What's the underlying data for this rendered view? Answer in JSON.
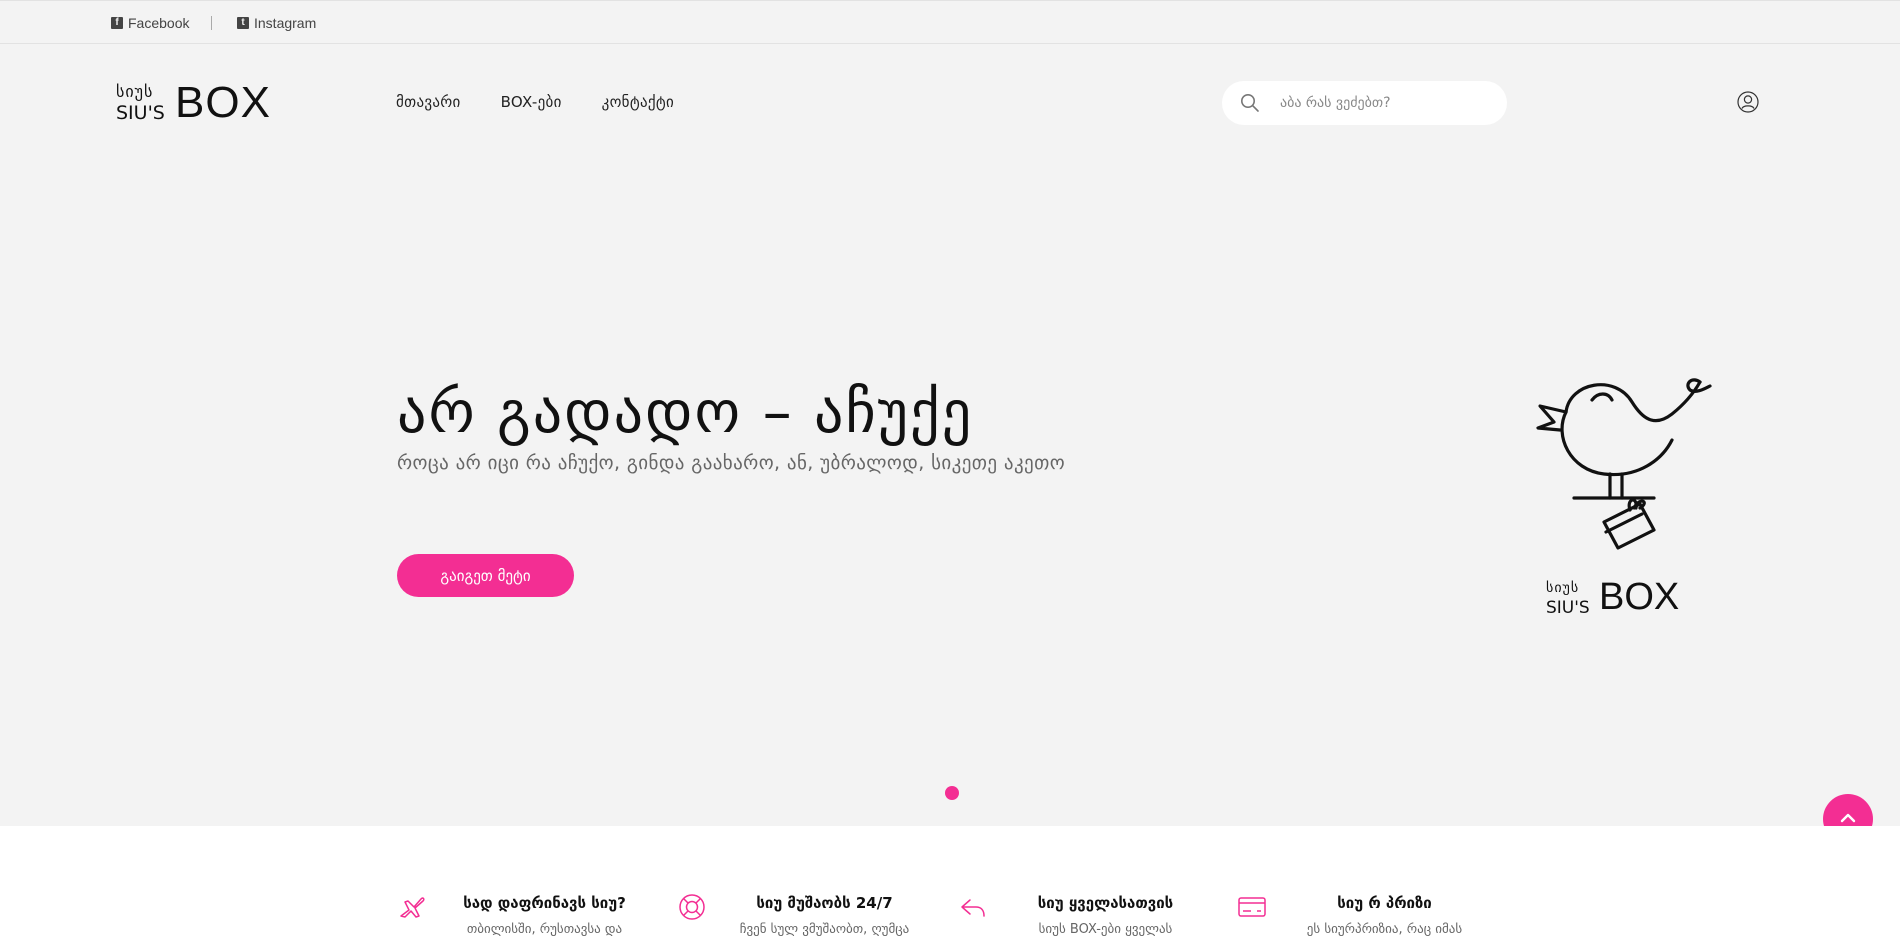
{
  "topbar": {
    "facebook_label": "Facebook",
    "instagram_label": "Instagram"
  },
  "logo": {
    "line1": "სიუს",
    "line2": "SIU'S",
    "word": "BOX"
  },
  "nav": {
    "items": [
      {
        "label": "მთავარი"
      },
      {
        "label": "BOX-ები"
      },
      {
        "label": "კონტაქტი"
      }
    ]
  },
  "search": {
    "placeholder": "აბა რას ვეძებთ?"
  },
  "hero": {
    "title": "არ გადადო – აჩუქე",
    "subtitle": "როცა არ იცი რა აჩუქო, გინდა გაახარო, ან, უბრალოდ, სიკეთე აკეთო",
    "button_label": "გაიგეთ მეტი"
  },
  "hero_logo": {
    "line1": "სიუს",
    "line2": "SIU'S",
    "word": "BOX"
  },
  "features": [
    {
      "icon": "airplane-icon",
      "title": "სად დაფრინავს სიუ?",
      "text": "თბილისში, რუსთავსა და"
    },
    {
      "icon": "lifebuoy-icon",
      "title": "სიუ მუშაობს 24/7",
      "text": "ჩვენ სულ ვმუშაობთ, ღუმცა"
    },
    {
      "icon": "reply-icon",
      "title": "სიუ ყველასათვის",
      "text": "სიუს BOX-ები ყველას"
    },
    {
      "icon": "credit-card-icon",
      "title": "სიუ რ პრიზი",
      "text": "ეს სიურპრიზია, რაც იმას"
    }
  ],
  "colors": {
    "accent": "#f32e93",
    "background": "#f3f3f3"
  }
}
